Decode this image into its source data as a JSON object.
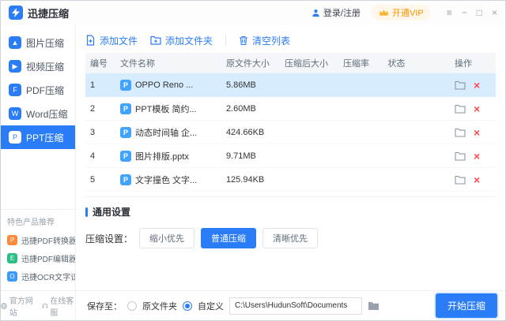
{
  "colors": {
    "primary": "#2b7cf7",
    "danger": "#fb4b4b",
    "vip_orange": "#ff9100",
    "selected_row": "#d8ecff",
    "file_icon_blue": "#41a3ff"
  },
  "titlebar": {
    "app_name": "迅捷压缩",
    "login_label": "登录/注册",
    "vip_label": "开通VIP",
    "menu_glyph": "≡",
    "minimize_glyph": "−",
    "maximize_glyph": "□",
    "close_glyph": "×"
  },
  "sidebar": {
    "items": [
      {
        "label": "图片压缩",
        "icon": "▲",
        "active": false
      },
      {
        "label": "视频压缩",
        "icon": "▶",
        "active": false
      },
      {
        "label": "PDF压缩",
        "icon": "F",
        "active": false
      },
      {
        "label": "Word压缩",
        "icon": "W",
        "active": false
      },
      {
        "label": "PPT压缩",
        "icon": "P",
        "active": true
      }
    ],
    "featured_title": "特色产品推荐",
    "featured": [
      {
        "label": "迅捷PDF转换器",
        "icon": "P"
      },
      {
        "label": "迅捷PDF编辑器",
        "icon": "E"
      },
      {
        "label": "迅捷OCR文字识别软件",
        "icon": "O"
      }
    ],
    "footer_links": [
      {
        "label": "官方网站"
      },
      {
        "label": "在线客服"
      }
    ]
  },
  "toolbar": {
    "add_file": "添加文件",
    "add_folder": "添加文件夹",
    "clear_list": "清空列表"
  },
  "table": {
    "headers": [
      "编号",
      "文件名称",
      "原文件大小",
      "压缩后大小",
      "压缩率",
      "状态",
      "操作"
    ],
    "rows": [
      {
        "no": "1",
        "icon": "P",
        "name": "OPPO Reno ...",
        "original_size": "5.86MB",
        "compressed_size": "",
        "ratio": "",
        "progress": 0,
        "selected": true
      },
      {
        "no": "2",
        "icon": "P",
        "name": "PPT模板 简约...",
        "original_size": "2.60MB",
        "compressed_size": "",
        "ratio": "",
        "progress": 0,
        "selected": false
      },
      {
        "no": "3",
        "icon": "P",
        "name": "动态时间轴 企...",
        "original_size": "424.66KB",
        "compressed_size": "",
        "ratio": "",
        "progress": 0,
        "selected": false
      },
      {
        "no": "4",
        "icon": "P",
        "name": "图片排版.pptx",
        "original_size": "9.71MB",
        "compressed_size": "",
        "ratio": "",
        "progress": 0,
        "selected": false
      },
      {
        "no": "5",
        "icon": "P",
        "name": "文字撞色 文字...",
        "original_size": "125.94KB",
        "compressed_size": "",
        "ratio": "",
        "progress": 0,
        "selected": false
      }
    ]
  },
  "settings": {
    "section_title": "通用设置",
    "compress_label": "压缩设置：",
    "options": [
      {
        "label": "缩小优先",
        "selected": false
      },
      {
        "label": "普通压缩",
        "selected": true
      },
      {
        "label": "清晰优先",
        "selected": false
      }
    ]
  },
  "bottombar": {
    "save_label": "保存至：",
    "option_original": "原文件夹",
    "option_custom": "自定义",
    "custom_selected": true,
    "path_value": "C:\\Users\\HudunSoft\\Documents",
    "start_label": "开始压缩"
  }
}
